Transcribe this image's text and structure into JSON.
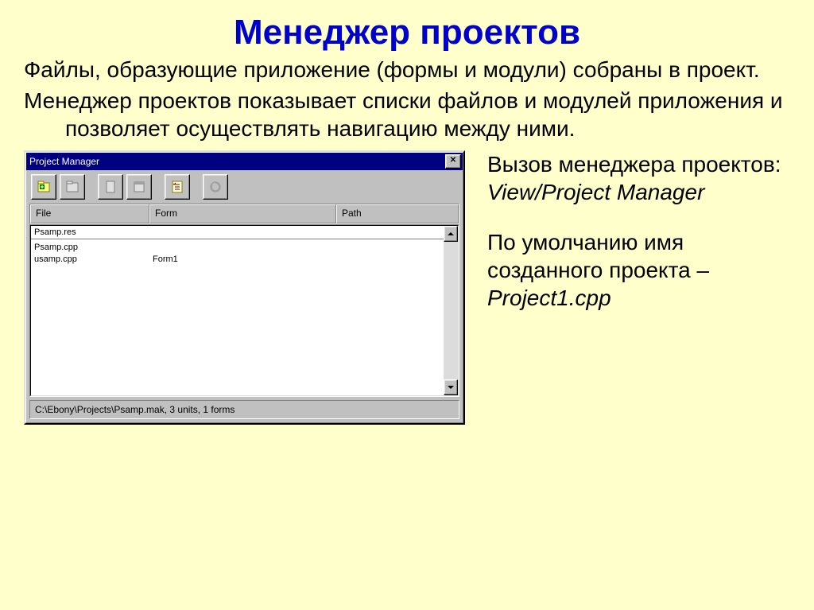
{
  "slide": {
    "title": "Менеджер проектов",
    "para1": "Файлы, образующие приложение (формы и модули) собраны в проект.",
    "para2": "Менеджер проектов показывает списки файлов и модулей приложения и позволяет осуществлять навигацию между ними."
  },
  "side": {
    "call_label": "Вызов менеджера проектов:",
    "call_menu": "View/Project Manager",
    "default_label": "По умолчанию имя созданного проекта –",
    "default_name": "Project1.cpp"
  },
  "pm": {
    "title": "Project Manager",
    "columns": {
      "file": "File",
      "form": "Form",
      "path": "Path"
    },
    "rows": [
      {
        "file": "Psamp.res",
        "form": "",
        "path": ""
      },
      {
        "file": "Psamp.cpp",
        "form": "",
        "path": ""
      },
      {
        "file": "usamp.cpp",
        "form": "Form1",
        "path": ""
      }
    ],
    "status": "C:\\Ebony\\Projects\\Psamp.mak, 3 units, 1 forms"
  }
}
